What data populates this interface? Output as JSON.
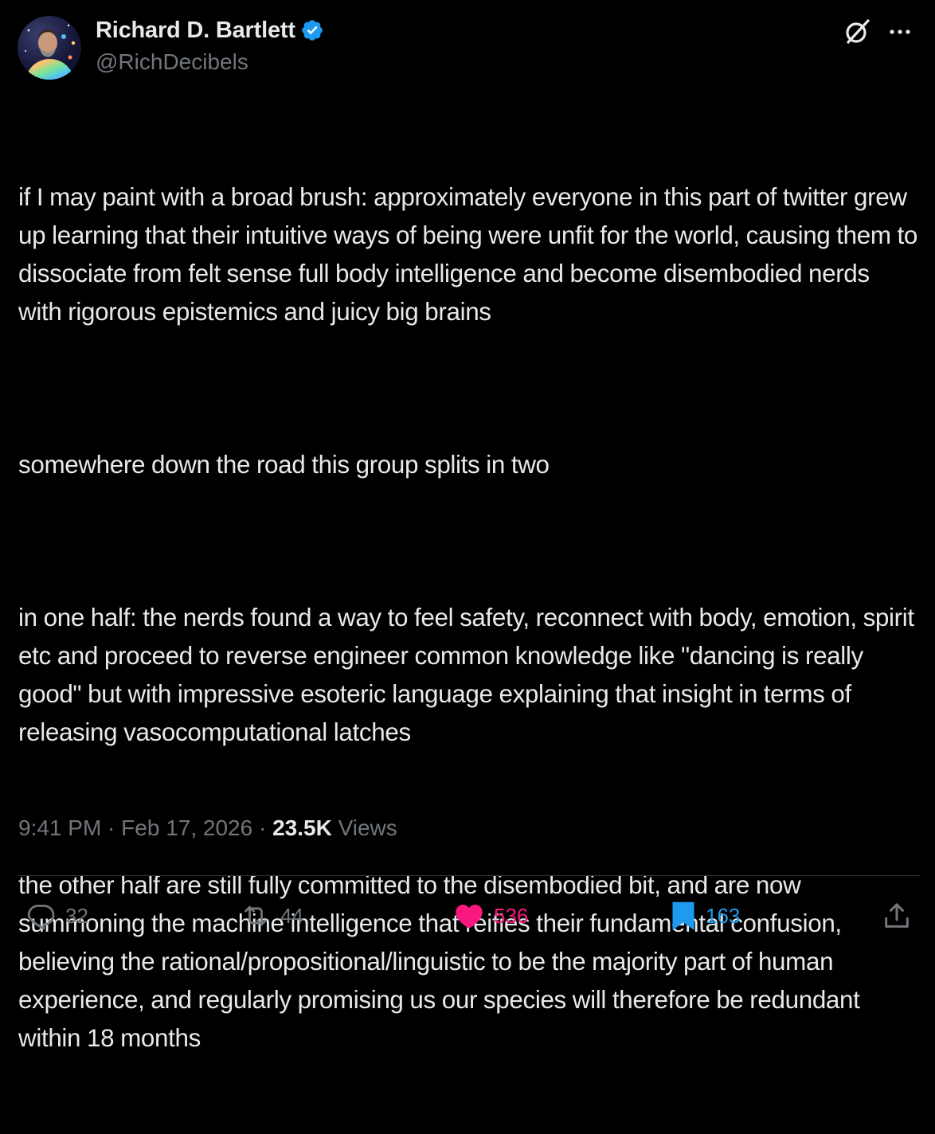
{
  "author": {
    "display_name": "Richard D. Bartlett",
    "handle": "@RichDecibels",
    "verified": true
  },
  "icons": {
    "avatar": "avatar",
    "verified": "verified-badge-icon",
    "grok": "grok-icon",
    "more": "more-icon",
    "reply": "reply-icon",
    "retweet": "retweet-icon",
    "like": "heart-icon",
    "bookmark": "bookmark-icon",
    "share": "share-icon"
  },
  "tweet": {
    "paragraphs": [
      "if I may paint with a broad brush: approximately everyone in this part of twitter grew up learning that their intuitive ways of being were unfit for the world, causing them to dissociate from felt sense full body intelligence and become disembodied nerds with rigorous epistemics and juicy big brains",
      "somewhere down the road this group splits in two",
      "in one half: the nerds found a way to feel safety, reconnect with body, emotion, spirit etc and proceed to reverse engineer common knowledge like \"dancing is really good\" but with impressive esoteric language explaining that insight in terms of releasing vasocomputational latches",
      "the other half are still fully committed to the disembodied bit, and are now summoning the machine intelligence that reifies their fundamental confusion, believing the rational/propositional/linguistic to be the majority part of human experience, and regularly promising us our species will therefore be redundant within 18 months"
    ],
    "time": "9:41 PM",
    "separator": " · ",
    "date": "Feb 17, 2026",
    "views_count": "23.5K",
    "views_label": "Views"
  },
  "actions": {
    "replies": "32",
    "retweets": "44",
    "likes": "536",
    "bookmarks": "163"
  },
  "colors": {
    "background": "#000000",
    "text": "#e7e9ea",
    "muted": "#71767b",
    "like": "#f91880",
    "bookmark": "#1d9bf0",
    "verified": "#1d9bf0",
    "divider": "#2f3336"
  }
}
